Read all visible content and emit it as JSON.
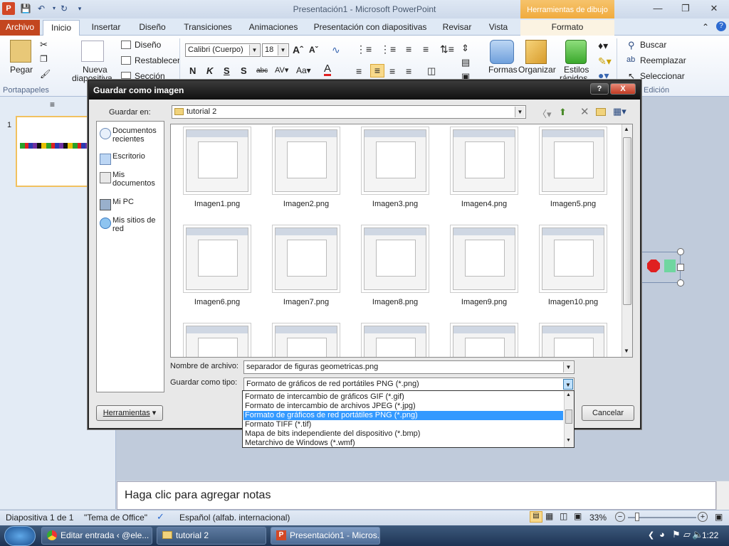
{
  "app": {
    "title": "Presentación1 - Microsoft PowerPoint",
    "context_tab_title": "Herramientas de dibujo"
  },
  "tabs": {
    "file": "Archivo",
    "home": "Inicio",
    "insert": "Insertar",
    "design": "Diseño",
    "transitions": "Transiciones",
    "animations": "Animaciones",
    "slideshow": "Presentación con diapositivas",
    "review": "Revisar",
    "view": "Vista",
    "format": "Formato"
  },
  "ribbon": {
    "paste": "Pegar",
    "new_slide_1": "Nueva",
    "new_slide_2": "diapositiva",
    "layout": "Diseño",
    "reset": "Restablecer",
    "section": "Sección",
    "font_name": "Calibri (Cuerpo)",
    "font_size": "18",
    "shapes": "Formas",
    "arrange": "Organizar",
    "quick_styles_1": "Estilos",
    "quick_styles_2": "rápidos",
    "find": "Buscar",
    "replace": "Reemplazar",
    "select": "Seleccionar",
    "group_clipboard": "Portapapeles",
    "group_editing": "Edición"
  },
  "slides": {
    "number": "1"
  },
  "notes": {
    "placeholder": "Haga clic para agregar notas"
  },
  "status": {
    "slide": "Diapositiva 1 de 1",
    "theme": "\"Tema de Office\"",
    "language": "Español (alfab. internacional)",
    "zoom": "33%"
  },
  "taskbar": {
    "items": [
      "Editar entrada ‹ @ele...",
      "tutorial 2",
      "Presentación1 - Micros..."
    ],
    "time": "1:22"
  },
  "dialog": {
    "title": "Guardar como imagen",
    "save_in_label": "Guardar en:",
    "folder": "tutorial 2",
    "places": [
      "Documentos recientes",
      "Escritorio",
      "Mis documentos",
      "Mi PC",
      "Mis sitios de red"
    ],
    "files": [
      "Imagen1.png",
      "Imagen2.png",
      "Imagen3.png",
      "Imagen4.png",
      "Imagen5.png",
      "Imagen6.png",
      "Imagen7.png",
      "Imagen8.png",
      "Imagen9.png",
      "Imagen10.png"
    ],
    "filename_label": "Nombre de archivo:",
    "filename": "separador de figuras geometricas.png",
    "type_label": "Guardar como tipo:",
    "type": "Formato de gráficos de red portátiles PNG (*.png)",
    "type_options": [
      "Formato de intercambio de gráficos GIF (*.gif)",
      "Formato de intercambio de archivos JPEG (*.jpg)",
      "Formato de gráficos de red portátiles PNG (*.png)",
      "Formato TIFF (*.tif)",
      "Mapa de bits independiente del dispositivo (*.bmp)",
      "Metarchivo de Windows (*.wmf)"
    ],
    "tools": "Herramientas",
    "cancel": "Cancelar",
    "help": "?",
    "close": "X"
  }
}
